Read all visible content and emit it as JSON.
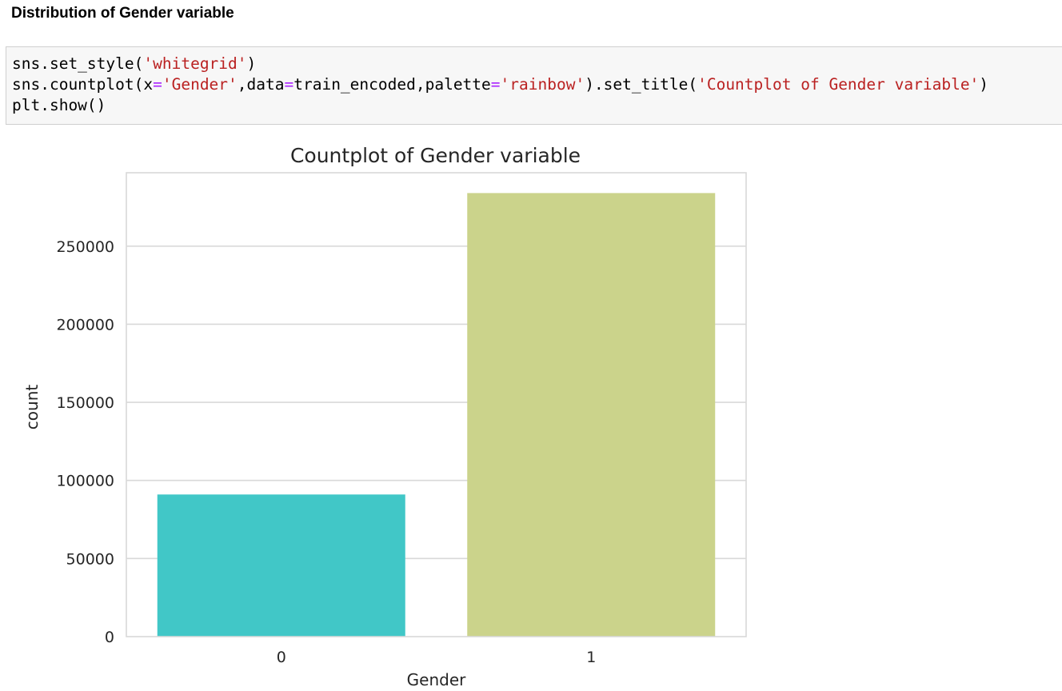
{
  "notebook": {
    "heading": "Distribution of Gender variable",
    "code_lines": [
      [
        {
          "t": "sns.set_style(",
          "k": "plain"
        },
        {
          "t": "'whitegrid'",
          "k": "str"
        },
        {
          "t": ")",
          "k": "plain"
        }
      ],
      [
        {
          "t": "sns.countplot(x",
          "k": "plain"
        },
        {
          "t": "=",
          "k": "op"
        },
        {
          "t": "'Gender'",
          "k": "str"
        },
        {
          "t": ",data",
          "k": "plain"
        },
        {
          "t": "=",
          "k": "op"
        },
        {
          "t": "train_encoded,palette",
          "k": "plain"
        },
        {
          "t": "=",
          "k": "op"
        },
        {
          "t": "'rainbow'",
          "k": "str"
        },
        {
          "t": ").set_title(",
          "k": "plain"
        },
        {
          "t": "'Countplot of Gender variable'",
          "k": "str"
        },
        {
          "t": ")",
          "k": "plain"
        }
      ],
      [
        {
          "t": "plt.show()",
          "k": "plain"
        }
      ]
    ]
  },
  "colors": {
    "code_string": "#ba2121",
    "code_operator": "#aa22ff",
    "code_background": "#f7f7f7",
    "grid": "#d9d9d9",
    "axes_border": "#d9d9d9"
  },
  "chart_data": {
    "type": "bar",
    "title": "Countplot of Gender variable",
    "xlabel": "Gender",
    "ylabel": "count",
    "categories": [
      "0",
      "1"
    ],
    "values": [
      91000,
      284000
    ],
    "bar_colors": [
      "#41c7c7",
      "#cbd38b"
    ],
    "ylim": [
      0,
      297000
    ],
    "yticks": [
      0,
      50000,
      100000,
      150000,
      200000,
      250000
    ],
    "ytick_labels": [
      "0",
      "50000",
      "100000",
      "150000",
      "200000",
      "250000"
    ],
    "grid": true,
    "style": "whitegrid"
  }
}
